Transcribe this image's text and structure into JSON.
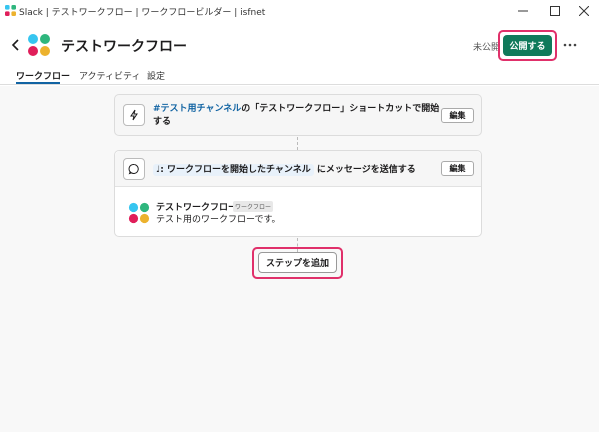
{
  "window": {
    "title": "Slack | テストワークフロー | ワークフロービルダー | isfnet",
    "icon": "slack-icon",
    "controls": [
      "minimize-icon",
      "maximize-icon",
      "close-icon"
    ]
  },
  "header": {
    "workflow_name": "テストワークフロー",
    "status": "未公開",
    "publish_label": "公開する",
    "more_icon": "more-horizontal-icon",
    "back_icon": "chevron-left-icon"
  },
  "tabs": [
    {
      "label": "ワークフロー",
      "active": true
    },
    {
      "label": "アクティビティ",
      "active": false
    },
    {
      "label": "設定",
      "active": false
    }
  ],
  "trigger": {
    "icon": "lightning-icon",
    "channel": "#テスト用チャンネル",
    "text_line1_rest": "の「テストワークフロー」ショートカットで開始",
    "text_line2": "する",
    "edit_label": "編集"
  },
  "step": {
    "icon": "message-bubble-icon",
    "chip_prefix": "♩:",
    "chip_text": "ワークフローを開始したチャンネル",
    "text_rest": "にメッセージを送信する",
    "edit_label": "編集",
    "preview": {
      "sender": "テストワークフロー",
      "badge": "ワークフロー",
      "body": "テスト用のワークフローです。"
    }
  },
  "add_step_label": "ステップを追加",
  "colors": {
    "publish": "#0f7a5b",
    "highlight": "#e0306a",
    "link": "#1264a3",
    "tab_underline": "#1264a3"
  }
}
